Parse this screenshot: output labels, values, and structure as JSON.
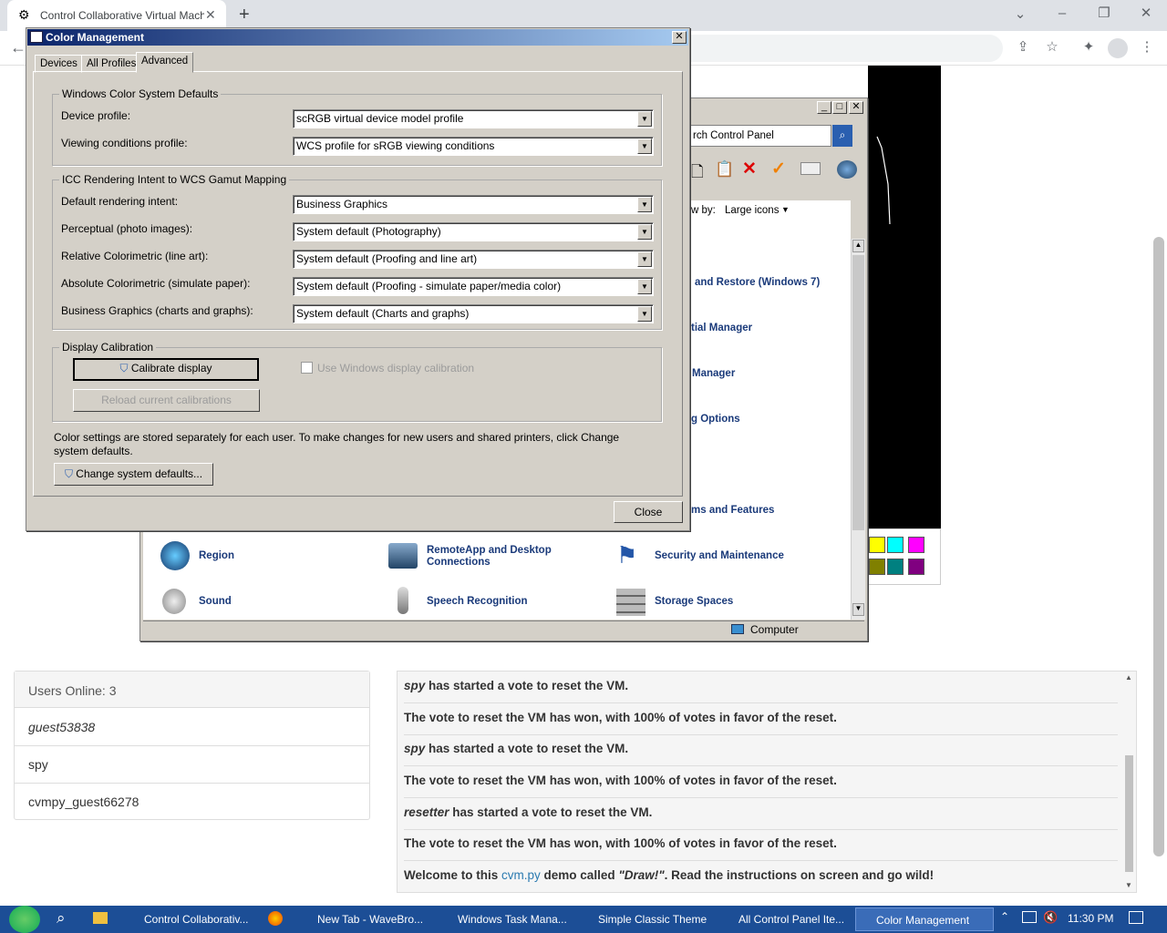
{
  "browser": {
    "tab_title": "Control Collaborative Virtual Machi",
    "new_tab": "+"
  },
  "control_panel": {
    "search_placeholder": "rch Control Panel",
    "view_by_label": "w by:",
    "view_by_value": "Large icons",
    "items": [
      {
        "label": "and Restore (Windows 7)"
      },
      {
        "label": "tial Manager"
      },
      {
        "label": "Manager"
      },
      {
        "label": "g Options"
      },
      {
        "label": "ms and Features"
      },
      {
        "label": "Region"
      },
      {
        "label": "RemoteApp and Desktop Connections"
      },
      {
        "label": "Security and Maintenance"
      },
      {
        "label": "Sound"
      },
      {
        "label": "Speech Recognition"
      },
      {
        "label": "Storage Spaces"
      }
    ],
    "status_computer": "Computer"
  },
  "color_mgmt": {
    "title": "Color Management",
    "tabs": [
      "Devices",
      "All Profiles",
      "Advanced"
    ],
    "wcs_group": "Windows Color System Defaults",
    "device_profile_label": "Device profile:",
    "device_profile_value": "scRGB virtual device model profile",
    "viewing_label": "Viewing conditions profile:",
    "viewing_value": "WCS profile for sRGB viewing conditions",
    "icc_group": "ICC Rendering Intent to WCS Gamut Mapping",
    "default_intent_label": "Default rendering intent:",
    "default_intent_value": "Business Graphics",
    "perceptual_label": "Perceptual (photo images):",
    "perceptual_value": "System default (Photography)",
    "relative_label": "Relative Colorimetric (line art):",
    "relative_value": "System default (Proofing and line art)",
    "absolute_label": "Absolute Colorimetric (simulate paper):",
    "absolute_value": "System default (Proofing - simulate paper/media color)",
    "business_label": "Business Graphics (charts and graphs):",
    "business_value": "System default (Charts and graphs)",
    "calib_group": "Display Calibration",
    "calibrate_button": "Calibrate display",
    "use_calibration_label": "Use Windows display calibration",
    "reload_button": "Reload current calibrations",
    "note": "Color settings are stored separately for each user. To make changes for new users and shared printers, click Change system defaults.",
    "change_defaults_button": "Change system defaults...",
    "close_button": "Close"
  },
  "users": {
    "header": "Users Online: 3",
    "list": [
      "guest53838",
      "spy",
      "cvmpy_guest66278"
    ]
  },
  "chat": {
    "messages": [
      {
        "user": "spy",
        "text": " has started a vote to reset the VM."
      },
      {
        "user": "",
        "text": "The vote to reset the VM has won, with 100% of votes in favor of the reset."
      },
      {
        "user": "spy",
        "text": " has started a vote to reset the VM."
      },
      {
        "user": "",
        "text": "The vote to reset the VM has won, with 100% of votes in favor of the reset."
      },
      {
        "user": "resetter",
        "text": " has started a vote to reset the VM."
      },
      {
        "user": "",
        "text": "The vote to reset the VM has won, with 100% of votes in favor of the reset."
      }
    ],
    "welcome_prefix": "Welcome to this ",
    "welcome_link": "cvm.py",
    "welcome_mid": " demo called ",
    "welcome_name": "\"Draw!\"",
    "welcome_suffix": ". Read the instructions on screen and go wild!"
  },
  "taskbar": {
    "items": [
      "Control Collaborativ...",
      "New Tab - WaveBro...",
      "Windows Task Mana...",
      "Simple Classic Theme",
      "All Control Panel Ite...",
      "Color Management"
    ],
    "clock": "11:30 PM"
  },
  "palette_colors": [
    "#ffff00",
    "#00ffff",
    "#ff00ff",
    "#808000",
    "#008080",
    "#800080"
  ]
}
